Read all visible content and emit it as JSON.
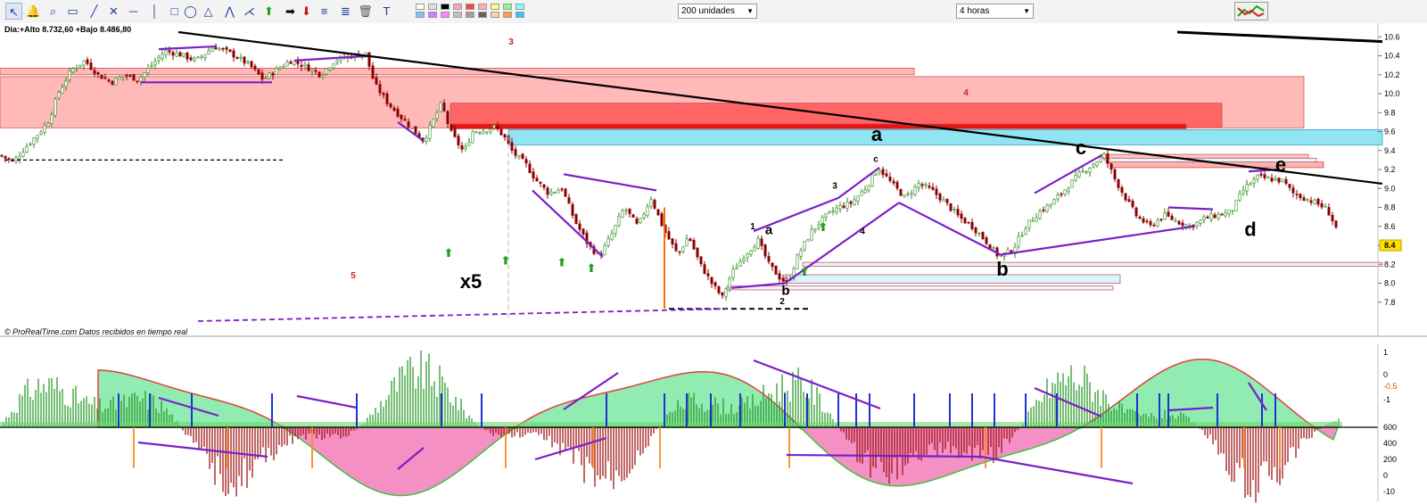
{
  "toolbar": {
    "units_dropdown": "200 unidades",
    "timeframe_dropdown": "4 horas",
    "tools": [
      "cursor-icon",
      "alarm-bell-icon",
      "zoom-icon",
      "ruler-icon",
      "line-icon",
      "cross-icon",
      "horizontal-line-icon",
      "vertical-line-icon",
      "rectangle-icon",
      "ellipse-icon",
      "triangle-icon",
      "fibonacci-fan-icon",
      "gann-icon",
      "arrow-up-icon",
      "arrow-right-icon",
      "arrow-down-icon",
      "fibonacci-retracement-icon",
      "fibonacci-extension-icon",
      "trash-icon",
      "text-icon"
    ],
    "swatch_colors": [
      "#ffffff",
      "#e0e0e0",
      "#000000",
      "#ff9ec0",
      "#ff4040",
      "#ffb0b0",
      "#ffff80",
      "#80ff80",
      "#80ffff",
      "#80c0ff",
      "#c080ff",
      "#ff80ff",
      "#c0c0c0",
      "#a0a0a0",
      "#606060",
      "#ffd0a0",
      "#ffa040",
      "#40c0ff"
    ]
  },
  "chart_data": [
    {
      "type": "candlestick",
      "header": "Dia:+Alto 8.732,60 +Bajo 8.486,80",
      "footer": "© ProRealTime.com  Datos recibidos en tiempo real",
      "ylim": [
        7.6,
        10.65
      ],
      "y_ticks": [
        "10.6",
        "10.4",
        "10.2",
        "10.0",
        "9.8",
        "9.6",
        "9.4",
        "9.2",
        "9.0",
        "8.8",
        "8.6",
        "8.4",
        "8.2",
        "8.0",
        "7.8"
      ],
      "last_price": "8.4",
      "colors": {
        "up": "#2d8a1e",
        "down": "#8b0000",
        "trendline": "#000000",
        "wave": "#7b1fc8",
        "resistance": "#ff4040",
        "support": "#40d8f0"
      },
      "price_path": [
        [
          0,
          9.35
        ],
        [
          15,
          9.28
        ],
        [
          30,
          9.45
        ],
        [
          45,
          9.6
        ],
        [
          55,
          9.72
        ],
        [
          65,
          10.0
        ],
        [
          80,
          10.25
        ],
        [
          95,
          10.35
        ],
        [
          110,
          10.2
        ],
        [
          125,
          10.12
        ],
        [
          140,
          10.2
        ],
        [
          155,
          10.15
        ],
        [
          170,
          10.3
        ],
        [
          185,
          10.45
        ],
        [
          200,
          10.42
        ],
        [
          220,
          10.35
        ],
        [
          240,
          10.5
        ],
        [
          260,
          10.42
        ],
        [
          280,
          10.3
        ],
        [
          295,
          10.15
        ],
        [
          310,
          10.25
        ],
        [
          325,
          10.35
        ],
        [
          340,
          10.3
        ],
        [
          360,
          10.2
        ],
        [
          375,
          10.35
        ],
        [
          395,
          10.4
        ],
        [
          410,
          10.42
        ],
        [
          420,
          10.1
        ],
        [
          435,
          9.9
        ],
        [
          450,
          9.75
        ],
        [
          465,
          9.6
        ],
        [
          475,
          9.5
        ],
        [
          485,
          9.7
        ],
        [
          495,
          9.9
        ],
        [
          505,
          9.6
        ],
        [
          520,
          9.38
        ],
        [
          530,
          9.6
        ],
        [
          545,
          9.62
        ],
        [
          555,
          9.65
        ],
        [
          565,
          9.55
        ],
        [
          575,
          9.38
        ],
        [
          590,
          9.25
        ],
        [
          600,
          9.1
        ],
        [
          615,
          8.95
        ],
        [
          630,
          9.0
        ],
        [
          645,
          8.65
        ],
        [
          660,
          8.4
        ],
        [
          672,
          8.28
        ],
        [
          685,
          8.5
        ],
        [
          700,
          8.8
        ],
        [
          715,
          8.6
        ],
        [
          730,
          8.9
        ],
        [
          745,
          8.55
        ],
        [
          760,
          8.3
        ],
        [
          772,
          8.5
        ],
        [
          785,
          8.2
        ],
        [
          798,
          8.0
        ],
        [
          810,
          7.85
        ],
        [
          820,
          8.1
        ],
        [
          835,
          8.3
        ],
        [
          850,
          8.45
        ],
        [
          862,
          8.2
        ],
        [
          875,
          8.05
        ],
        [
          883,
          8.0
        ],
        [
          895,
          8.3
        ],
        [
          910,
          8.55
        ],
        [
          925,
          8.7
        ],
        [
          940,
          8.8
        ],
        [
          955,
          8.85
        ],
        [
          970,
          9.0
        ],
        [
          985,
          9.22
        ],
        [
          1000,
          9.05
        ],
        [
          1015,
          8.9
        ],
        [
          1030,
          9.05
        ],
        [
          1045,
          8.98
        ],
        [
          1060,
          8.85
        ],
        [
          1075,
          8.7
        ],
        [
          1090,
          8.6
        ],
        [
          1105,
          8.45
        ],
        [
          1120,
          8.28
        ],
        [
          1135,
          8.35
        ],
        [
          1150,
          8.6
        ],
        [
          1165,
          8.75
        ],
        [
          1180,
          8.85
        ],
        [
          1195,
          9.0
        ],
        [
          1210,
          9.15
        ],
        [
          1225,
          9.25
        ],
        [
          1238,
          9.35
        ],
        [
          1250,
          9.1
        ],
        [
          1262,
          8.9
        ],
        [
          1275,
          8.7
        ],
        [
          1290,
          8.6
        ],
        [
          1305,
          8.72
        ],
        [
          1320,
          8.65
        ],
        [
          1335,
          8.6
        ],
        [
          1350,
          8.68
        ],
        [
          1365,
          8.72
        ],
        [
          1380,
          8.75
        ],
        [
          1395,
          9.0
        ],
        [
          1410,
          9.12
        ],
        [
          1425,
          9.1
        ],
        [
          1438,
          9.08
        ],
        [
          1450,
          8.95
        ],
        [
          1462,
          8.9
        ],
        [
          1475,
          8.85
        ],
        [
          1488,
          8.78
        ],
        [
          1500,
          8.55
        ]
      ],
      "annotations": [
        {
          "text": "a",
          "x": 983,
          "y": 9.5,
          "size": "large"
        },
        {
          "text": "c",
          "x": 1212,
          "y": 9.36,
          "size": "large"
        },
        {
          "text": "e",
          "x": 1436,
          "y": 9.18,
          "size": "large"
        },
        {
          "text": "d",
          "x": 1402,
          "y": 8.5,
          "size": "large"
        },
        {
          "text": "b",
          "x": 1124,
          "y": 8.08,
          "size": "large"
        },
        {
          "text": "x5",
          "x": 528,
          "y": 7.95,
          "size": "large"
        },
        {
          "text": "a",
          "x": 862,
          "y": 8.52,
          "size": "medium"
        },
        {
          "text": "b",
          "x": 881,
          "y": 7.88,
          "size": "medium"
        },
        {
          "text": "1",
          "x": 844,
          "y": 8.57,
          "size": "small"
        },
        {
          "text": "2",
          "x": 877,
          "y": 7.78,
          "size": "small"
        },
        {
          "text": "3",
          "x": 936,
          "y": 9.0,
          "size": "small"
        },
        {
          "text": "4",
          "x": 967,
          "y": 8.52,
          "size": "small"
        },
        {
          "text": "c",
          "x": 982,
          "y": 9.28,
          "size": "small"
        },
        {
          "text": "3",
          "x": 573,
          "y": 10.52,
          "size": "small-red"
        },
        {
          "text": "4",
          "x": 1083,
          "y": 9.98,
          "size": "small-red"
        },
        {
          "text": "5",
          "x": 396,
          "y": 8.05,
          "size": "small-red"
        }
      ]
    },
    {
      "type": "histogram",
      "ylim": [
        -1.1,
        1.1
      ],
      "y_ticks_right": [
        "1",
        "0",
        "-0.5",
        "-1"
      ],
      "y_ticks_volume": [
        "600",
        "400",
        "200",
        "0",
        "-10"
      ],
      "colors": {
        "positive": "#2e9a2e",
        "negative": "#a01515",
        "cloud_up": "#90ecb0",
        "cloud_down": "#f490c4"
      }
    }
  ]
}
